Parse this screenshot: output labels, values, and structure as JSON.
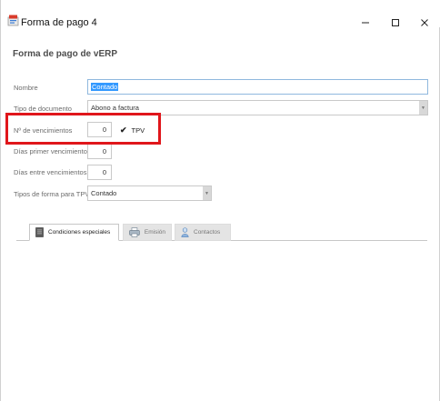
{
  "window": {
    "title": "Forma de pago 4"
  },
  "form": {
    "heading": "Forma de pago de vERP",
    "nombre": {
      "label": "Nombre",
      "value": "Contado"
    },
    "tipo_documento": {
      "label": "Tipo de documento",
      "value": "Abono a factura"
    },
    "num_vencimientos": {
      "label": "Nº de vencimientos",
      "value": "0"
    },
    "tpv": {
      "label": "TPV",
      "checked": true
    },
    "dias_primer": {
      "label": "Días primer vencimiento",
      "value": "0"
    },
    "dias_entre": {
      "label": "Días entre vencimientos",
      "value": "0"
    },
    "tipo_tpv": {
      "label": "Tipos de forma para TPV",
      "value": "Contado"
    }
  },
  "tabs": [
    {
      "label": "Condiciones especiales",
      "icon": "document-icon",
      "active": true
    },
    {
      "label": "Emisión",
      "icon": "printer-icon",
      "active": false
    },
    {
      "label": "Contactos",
      "icon": "person-icon",
      "active": false
    }
  ],
  "colors": {
    "highlight": "#e0161b",
    "selection": "#3399ff",
    "active_field_border": "#8fb8de"
  }
}
